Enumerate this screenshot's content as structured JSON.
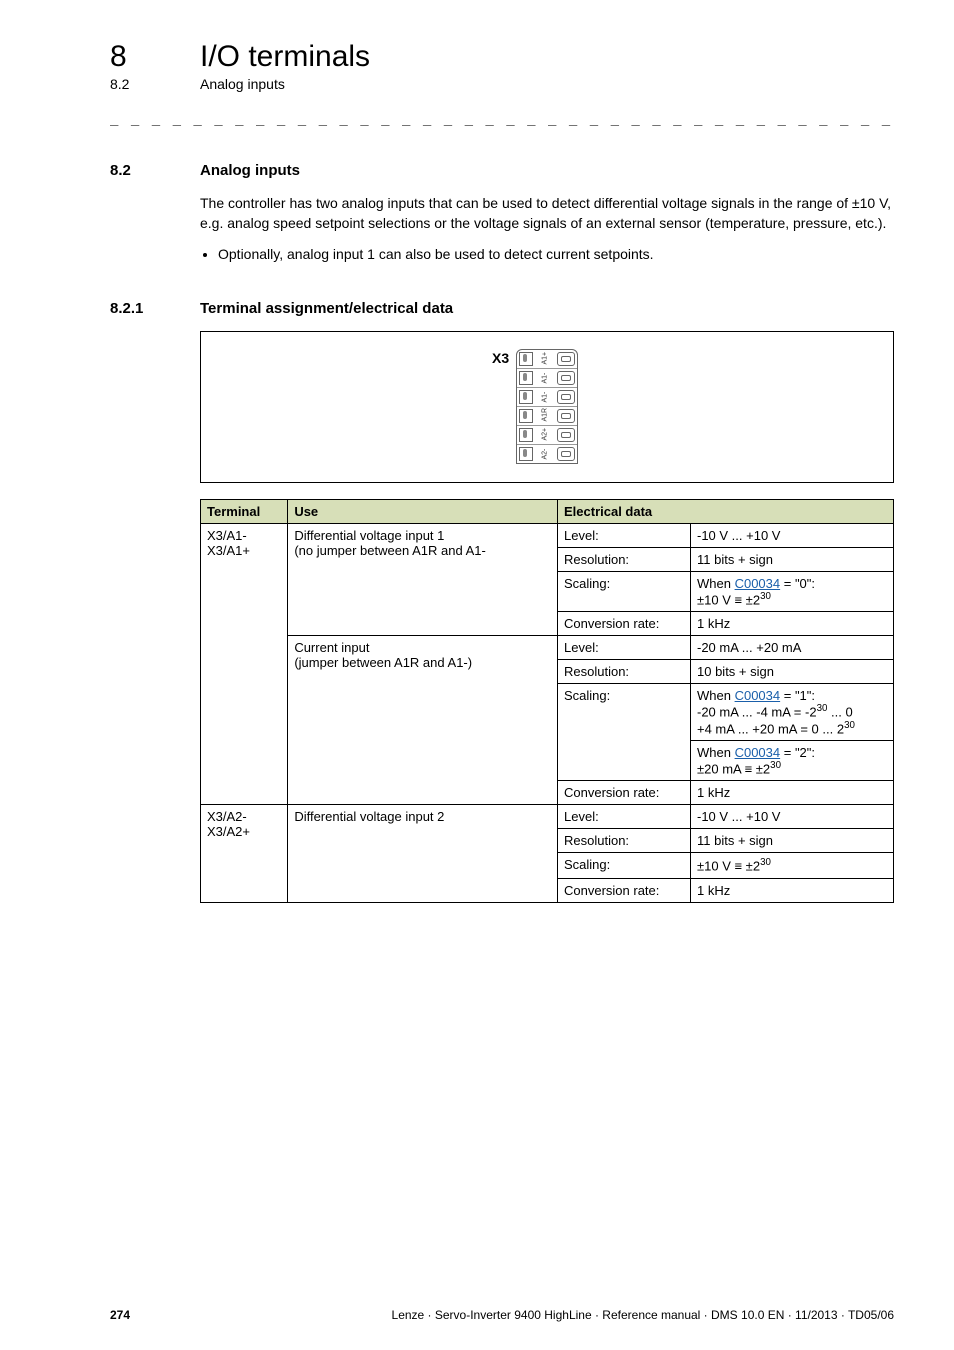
{
  "chapter": {
    "num": "8",
    "title": "I/O terminals"
  },
  "subchapter": {
    "num": "8.2",
    "title": "Analog inputs"
  },
  "dashes": "_ _ _ _ _ _ _ _ _ _ _ _ _ _ _ _ _ _ _ _ _ _ _ _ _ _ _ _ _ _ _ _ _ _ _ _ _ _ _ _ _ _ _ _ _ _ _ _ _ _ _ _ _ _ _ _ _ _ _ _ _ _ _ _",
  "sec82": {
    "num": "8.2",
    "title": "Analog inputs",
    "para": "The controller has two analog inputs that can be used to detect differential voltage signals in the range of ±10 V, e.g. analog speed setpoint selections or the voltage signals of an external sensor (temperature, pressure, etc.).",
    "bullet1": "Optionally, analog input 1 can also be used to detect current setpoints."
  },
  "sec821": {
    "num": "8.2.1",
    "title": "Terminal assignment/electrical data"
  },
  "diagram": {
    "label": "X3",
    "pins": [
      "A1+",
      "A1-",
      "A1-",
      "A1R",
      "A2+",
      "A2-"
    ]
  },
  "table": {
    "headers": {
      "h1": "Terminal",
      "h2": "Use",
      "h3": "Electrical data"
    },
    "term1a": "X3/A1-",
    "term1b": "X3/A1+",
    "use1a_l1": "Differential voltage input 1",
    "use1a_l2": "(no jumper between A1R and A1-",
    "use1b_l1": "Current input",
    "use1b_l2": "(jumper between A1R and A1-)",
    "term2a": "X3/A2-",
    "term2b": "X3/A2+",
    "use2": "Differential voltage input 2",
    "labels": {
      "level": "Level:",
      "resolution": "Resolution:",
      "scaling": "Scaling:",
      "convrate": "Conversion rate:"
    },
    "vals": {
      "a1v_level": "-10 V ... +10 V",
      "a1v_res": "11 bits + sign",
      "a1v_scal_pre": "When ",
      "a1v_scal_link": "C00034",
      "a1v_scal_post": " = \"0\":",
      "a1v_scal_l2a": "±10 V ≡ ±2",
      "a1v_scal_l2b": "30",
      "a1v_conv": "1 kHz",
      "a1c_level": "-20 mA ... +20 mA",
      "a1c_res": "10 bits + sign",
      "a1c_s1_pre": "When ",
      "a1c_s1_link": "C00034",
      "a1c_s1_post": " = \"1\":",
      "a1c_s1_l2a": "-20 mA ... -4 mA = -2",
      "a1c_s1_l2b": "30",
      "a1c_s1_l2c": " ... 0",
      "a1c_s1_l3a": "+4 mA ... +20 mA = 0 ... 2",
      "a1c_s1_l3b": "30",
      "a1c_s2_pre": "When ",
      "a1c_s2_link": "C00034",
      "a1c_s2_post": " = \"2\":",
      "a1c_s2_l2a": "±20 mA ≡ ±2",
      "a1c_s2_l2b": "30",
      "a1c_conv": "1 kHz",
      "a2_level": "-10 V ... +10 V",
      "a2_res": "11 bits + sign",
      "a2_scal_a": "±10 V ≡ ±2",
      "a2_scal_b": "30",
      "a2_conv": "1 kHz"
    }
  },
  "footer": {
    "page": "274",
    "meta": "Lenze · Servo-Inverter 9400 HighLine · Reference manual · DMS 10.0 EN · 11/2013 · TD05/06"
  }
}
